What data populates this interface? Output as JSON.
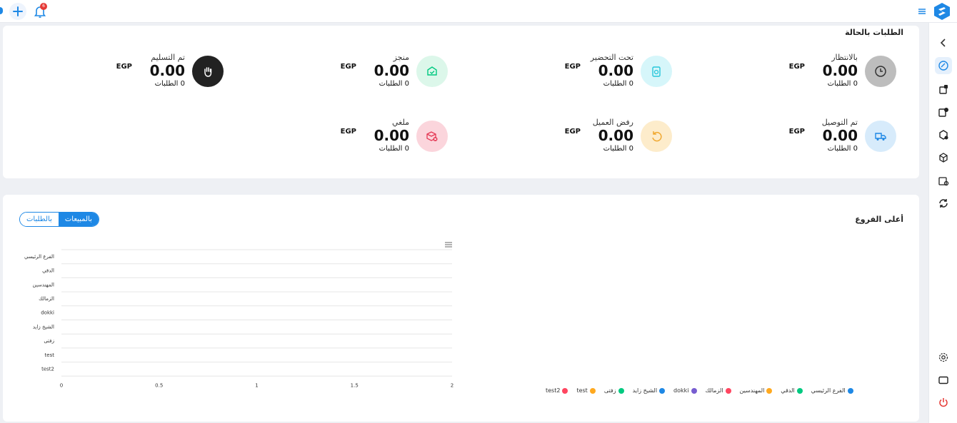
{
  "topbar": {
    "notifications_count": "6",
    "plus_icon": "plus-icon",
    "bell_icon": "bell-icon",
    "menu_icon": "menu-icon",
    "accent": "#1e88e5"
  },
  "sidebar": {
    "items": [
      {
        "icon": "chevron-left-icon",
        "active": false
      },
      {
        "icon": "dashboard-icon",
        "active": true
      },
      {
        "icon": "orders-icon",
        "active": false
      },
      {
        "icon": "returns-icon",
        "active": false
      },
      {
        "icon": "delivery-icon",
        "active": false
      },
      {
        "icon": "box-icon",
        "active": false
      },
      {
        "icon": "stores-icon",
        "active": false
      },
      {
        "icon": "sync-icon",
        "active": false
      },
      {
        "icon": "settings-icon",
        "active": false
      },
      {
        "icon": "screen-icon",
        "active": false
      },
      {
        "icon": "power-icon",
        "active": false
      }
    ]
  },
  "status_section": {
    "title": "الطلبات بالحالة",
    "items": [
      {
        "label": "بالانتظار",
        "amount": "0.00",
        "currency": "EGP",
        "count": "0 الطلبات",
        "icon": "clock-icon",
        "color": "#bdbdbd"
      },
      {
        "label": "تحت التحضير",
        "amount": "0.00",
        "currency": "EGP",
        "count": "0 الطلبات",
        "icon": "clipboard-icon",
        "color": "#d6f6fa"
      },
      {
        "label": "منجز",
        "amount": "0.00",
        "currency": "EGP",
        "count": "0 الطلبات",
        "icon": "box-check-icon",
        "color": "#dcf7ea"
      },
      {
        "label": "تم التسليم",
        "amount": "0.00",
        "currency": "EGP",
        "count": "0 الطلبات",
        "icon": "hand-icon",
        "color": "#222222"
      },
      {
        "label": "تم التوصيل",
        "amount": "0.00",
        "currency": "EGP",
        "count": "0 الطلبات",
        "icon": "truck-icon",
        "color": "#d7ebfb"
      },
      {
        "label": "رفض العميل",
        "amount": "0.00",
        "currency": "EGP",
        "count": "0 الطلبات",
        "icon": "undo-icon",
        "color": "#fdeccb"
      },
      {
        "label": "ملغي",
        "amount": "0.00",
        "currency": "EGP",
        "count": "0 الطلبات",
        "icon": "box-cancel-icon",
        "color": "#fbd5dc"
      }
    ]
  },
  "branches_section": {
    "title": "أعلى الفروع",
    "toggle": {
      "sales_label": "بالمبيعات",
      "orders_label": "بالطلبات",
      "selected": "sales"
    },
    "menu_icon": "menu-icon"
  },
  "chart_data": {
    "type": "bar",
    "orientation": "horizontal",
    "categories": [
      "الفرع الرئيسي",
      "الدقي",
      "المهندسين",
      "الزمالك",
      "dokki",
      "الشيخ زايد",
      "زفتى",
      "test",
      "test2"
    ],
    "values": [
      0,
      0,
      0,
      0,
      0,
      0,
      0,
      0,
      0
    ],
    "xlim": [
      0,
      2
    ],
    "x_ticks": [
      "0",
      "0.5",
      "1",
      "1.5",
      "2"
    ],
    "grid": true,
    "legend_placement": "bottom-right",
    "legend": [
      {
        "name": "الفرع الرئيسي",
        "color": "#1e88e5"
      },
      {
        "name": "الدقي",
        "color": "#00c980"
      },
      {
        "name": "المهندسين",
        "color": "#ffa91f"
      },
      {
        "name": "الزمالك",
        "color": "#ff4560"
      },
      {
        "name": "dokki",
        "color": "#775dd0"
      },
      {
        "name": "الشيخ زايد",
        "color": "#1e88e5"
      },
      {
        "name": "زفتى",
        "color": "#00c980"
      },
      {
        "name": "test",
        "color": "#ffa91f"
      },
      {
        "name": "test2",
        "color": "#ff4560"
      }
    ]
  }
}
